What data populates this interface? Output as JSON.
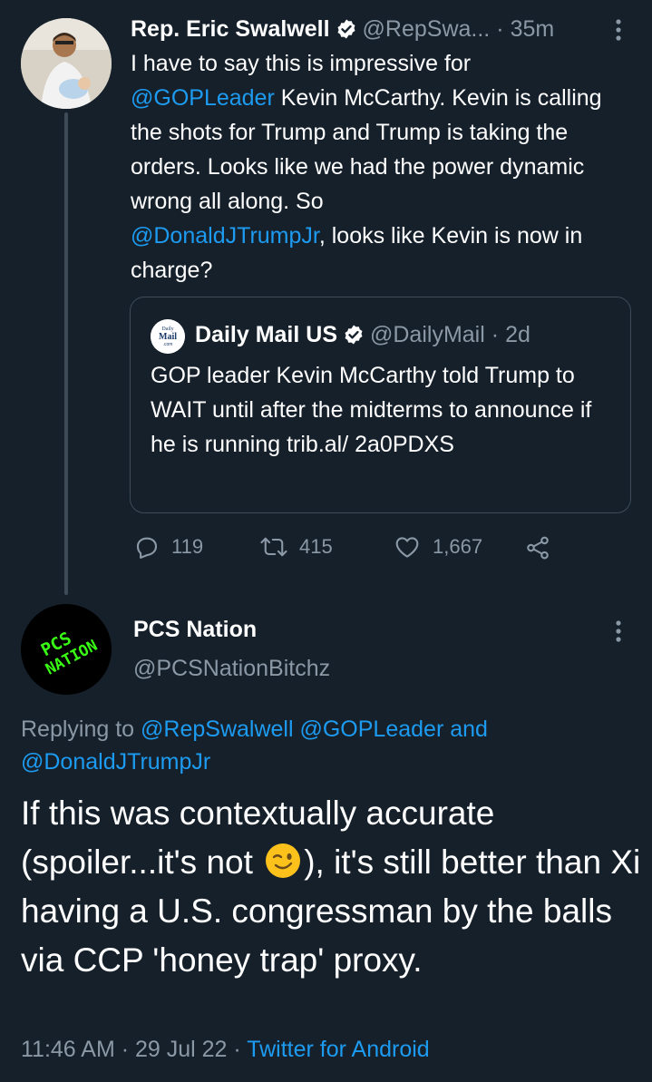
{
  "parent_tweet": {
    "author_name": "Rep. Eric Swalwell",
    "author_handle": "@RepSwa...",
    "time_dot": "·",
    "time": "35m",
    "body": [
      {
        "t": "I have to say this is impressive for\n",
        "link": false
      },
      {
        "t": "@GOPLeader",
        "link": true
      },
      {
        "t": " Kevin McCarthy. Kevin is calling the shots for Trump and Trump is taking the orders. Looks like we had the power dynamic wrong all along. So\n",
        "link": false
      },
      {
        "t": "@DonaldJTrumpJr",
        "link": true
      },
      {
        "t": ", looks like Kevin is now in charge?",
        "link": false
      }
    ],
    "quoted_tweet": {
      "author_name": "Daily Mail US",
      "author_handle": "@DailyMail",
      "time_dot": "·",
      "time": "2d",
      "avatar_text": [
        "Daily",
        "Mail",
        ".com"
      ],
      "body": "GOP leader Kevin McCarthy told Trump to WAIT until after the midterms to announce if he is running trib.al/ 2a0PDXS"
    },
    "actions": {
      "reply_count": "119",
      "retweet_count": "415",
      "like_count": "1,667"
    }
  },
  "reply_tweet": {
    "author_name": "PCS Nation",
    "author_handle": "@PCSNationBitchz",
    "avatar_text": [
      "PCS",
      "NATION"
    ],
    "replying_prefix": "Replying to ",
    "replying_to_1": "@RepSwalwell",
    "replying_to_2": "@GOPLeader",
    "replying_and": " and",
    "replying_to_3": "@DonaldJTrumpJr",
    "body_part1": "If this was contextually accurate (spoiler...it's not ",
    "emoji": "winking-face",
    "body_part2": "), it's still better than Xi having a U.S. congressman by the balls via CCP 'honey trap' proxy.",
    "time": "11:46 AM",
    "meta_dot": " · ",
    "date": "29 Jul 22",
    "meta_dot2": " · ",
    "source": "Twitter for Android"
  },
  "colors": {
    "background": "#15202b",
    "text": "#ffffff",
    "secondary": "#8b98a5",
    "link": "#1d9bf0",
    "border": "#3d4b59",
    "avatar_text_green": "#39ff14"
  }
}
